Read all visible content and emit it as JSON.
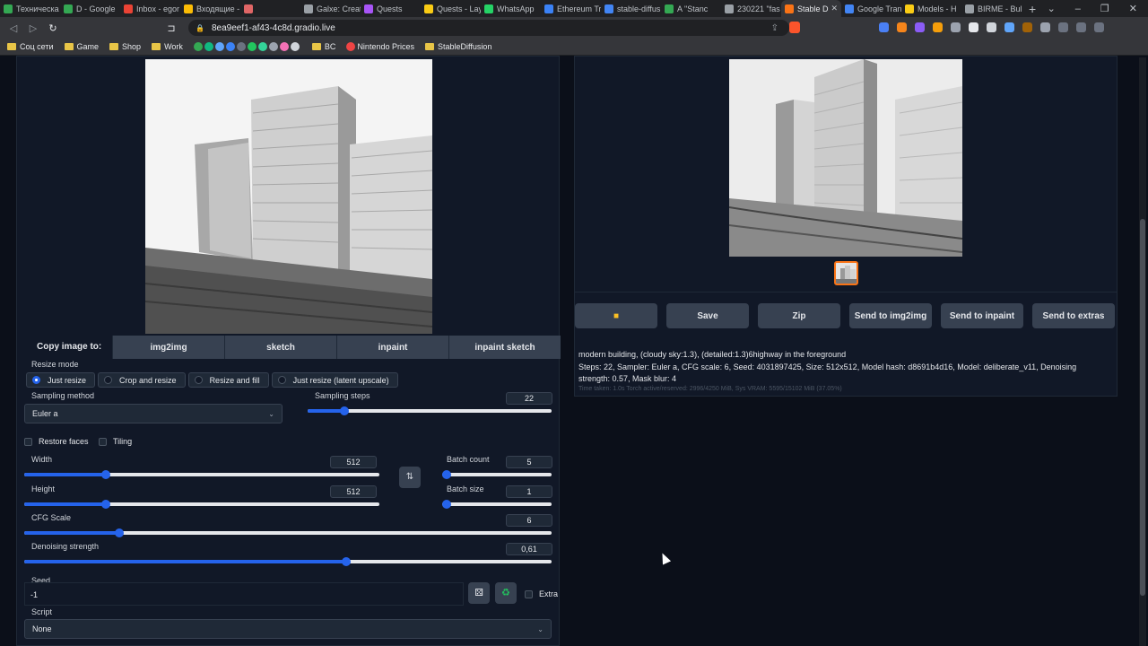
{
  "browser": {
    "tabs": [
      {
        "title": "Техническа",
        "color": "#34a853"
      },
      {
        "title": "D - Google",
        "color": "#34a853"
      },
      {
        "title": "Inbox - egor",
        "color": "#ea4335"
      },
      {
        "title": "Входящие -",
        "color": "#fbbc05"
      },
      {
        "title": "",
        "color": "#e06666"
      },
      {
        "title": "Galxe: Creat",
        "color": "#9aa0a6"
      },
      {
        "title": "Quests",
        "color": "#a855f7"
      },
      {
        "title": "Quests - Lay",
        "color": "#facc15"
      },
      {
        "title": "WhatsApp",
        "color": "#25d366"
      },
      {
        "title": "Ethereum Tr",
        "color": "#3b82f6"
      },
      {
        "title": "stable-diffus",
        "color": "#4285f4"
      },
      {
        "title": "A \"Stanc",
        "color": "#34a853"
      },
      {
        "title": "230221 \"fas",
        "color": "#9aa0a6"
      },
      {
        "title": "Stable D",
        "color": "#f97316"
      },
      {
        "title": "Google Tran",
        "color": "#4285f4"
      },
      {
        "title": "Models - H",
        "color": "#facc15"
      },
      {
        "title": "BIRME - Bul",
        "color": "#9aa0a6"
      }
    ],
    "active_tab_index": 13,
    "url": "8ea9eef1-af43-4c8d.gradio.live",
    "bookmarks": [
      "Соц сети",
      "Game",
      "Shop",
      "Work",
      "BC",
      "Nintendo Prices",
      "StableDiffusion"
    ]
  },
  "left": {
    "copy_label": "Copy image to:",
    "copy_targets": [
      "img2img",
      "sketch",
      "inpaint",
      "inpaint sketch"
    ],
    "resize_mode": {
      "label": "Resize mode",
      "options": [
        "Just resize",
        "Crop and resize",
        "Resize and fill",
        "Just resize (latent upscale)"
      ],
      "selected_index": 0
    },
    "sampling_method": {
      "label": "Sampling method",
      "value": "Euler a"
    },
    "sampling_steps": {
      "label": "Sampling steps",
      "value": "22",
      "fraction": 0.15
    },
    "restore_faces": {
      "label": "Restore faces",
      "checked": false
    },
    "tiling": {
      "label": "Tiling",
      "checked": false
    },
    "width": {
      "label": "Width",
      "value": "512",
      "fraction": 0.23
    },
    "height": {
      "label": "Height",
      "value": "512",
      "fraction": 0.23
    },
    "batch_count": {
      "label": "Batch count",
      "value": "5",
      "fraction": 0.03
    },
    "batch_size": {
      "label": "Batch size",
      "value": "1",
      "fraction": 0.0
    },
    "cfg_scale": {
      "label": "CFG Scale",
      "value": "6",
      "fraction": 0.18
    },
    "denoising": {
      "label": "Denoising strength",
      "value": "0,61",
      "fraction": 0.61
    },
    "seed": {
      "label": "Seed",
      "value": "-1",
      "extra_label": "Extra"
    },
    "script": {
      "label": "Script",
      "value": "None"
    }
  },
  "right": {
    "actions": [
      "Save",
      "Zip",
      "Send to img2img",
      "Send to inpaint",
      "Send to extras"
    ],
    "prompt": "modern building, (cloudy sky:1.3), (detailed:1.3)6highway in the foreground",
    "params": "Steps: 22, Sampler: Euler a, CFG scale: 6, Seed: 4031897425, Size: 512x512, Model hash: d8691b4d16, Model: deliberate_v11, Denoising strength: 0.57, Mask blur: 4",
    "time": "Time taken: 1.0s  Torch active/reserved: 2996/4250 MiB, Sys VRAM: 5595/15102 MiB (37.05%)"
  }
}
